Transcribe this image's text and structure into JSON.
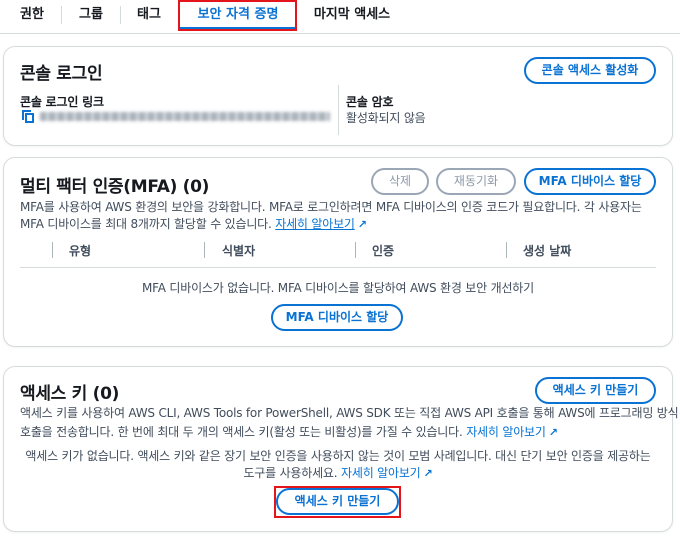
{
  "tabs": [
    {
      "label": "권한"
    },
    {
      "label": "그룹"
    },
    {
      "label": "태그"
    },
    {
      "label": "보안 자격 증명",
      "active": true
    },
    {
      "label": "마지막 액세스"
    }
  ],
  "console_login": {
    "title": "콘솔 로그인",
    "enable_button": "콘솔 액세스 활성화",
    "link_label": "콘솔 로그인 링크",
    "password_label": "콘솔 암호",
    "password_value": "활성화되지 않음"
  },
  "mfa": {
    "title": "멀티 팩터 인증(MFA) (0)",
    "delete_button": "삭제",
    "resync_button": "재동기화",
    "assign_button": "MFA 디바이스 할당",
    "desc_line1": "MFA를 사용하여 AWS 환경의 보안을 강화합니다. MFA로 로그인하려면 MFA 디바이스의 인증 코드가 필요합니다. 각 사용자는",
    "desc_line2": "MFA 디바이스를 최대 8개까지 할당할 수 있습니다.",
    "learn_more": "자세히 알아보기",
    "columns": [
      "유형",
      "식별자",
      "인증",
      "생성 날짜"
    ],
    "empty_text": "MFA 디바이스가 없습니다. MFA 디바이스를 할당하여 AWS 환경 보안 개선하기",
    "empty_button": "MFA 디바이스 할당"
  },
  "access_keys": {
    "title": "액세스 키 (0)",
    "create_button": "액세스 키 만들기",
    "desc_line1": "액세스 키를 사용하여 AWS CLI, AWS Tools for PowerShell, AWS SDK 또는 직접 AWS API 호출을 통해 AWS에 프로그래밍 방식",
    "desc_line2": "호출을 전송합니다. 한 번에 최대 두 개의 액세스 키(활성 또는 비활성)를 가질 수 있습니다.",
    "learn_more": "자세히 알아보기",
    "empty_line1": "액세스 키가 없습니다. 액세스 키와 같은 장기 보안 인증을 사용하지 않는 것이 모범 사례입니다. 대신 단기 보안 인증을 제공하는",
    "empty_line2": "도구를 사용하세요.",
    "empty_learn_more": "자세히 알아보기",
    "empty_button": "액세스 키 만들기"
  },
  "colors": {
    "accent": "#0972d3",
    "highlight": "#e3141a"
  }
}
